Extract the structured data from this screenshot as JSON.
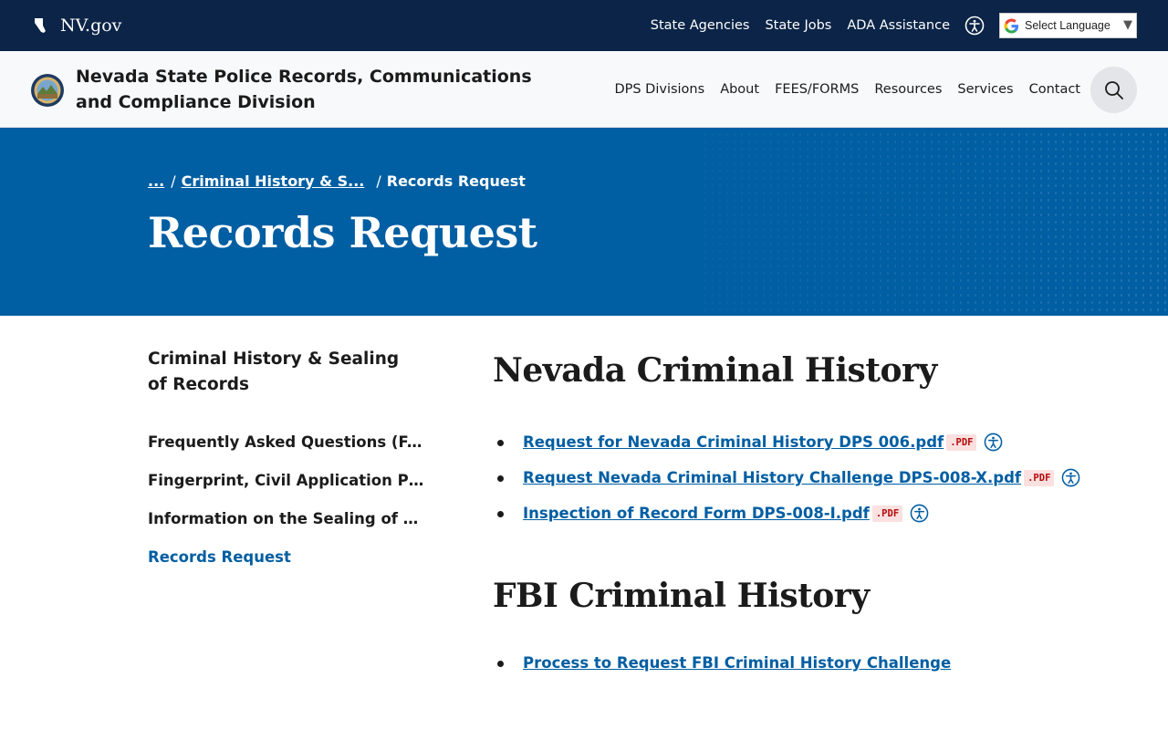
{
  "topbar": {
    "brand": "NV.gov",
    "links": [
      "State Agencies",
      "State Jobs",
      "ADA Assistance"
    ],
    "language_select": "Select Language"
  },
  "header": {
    "site_title": "Nevada State Police Records, Communications and Compliance Division",
    "nav": [
      "DPS Divisions",
      "About",
      "FEES/FORMS",
      "Resources",
      "Services",
      "Contact"
    ]
  },
  "hero": {
    "breadcrumb": {
      "ellipsis": "...",
      "parent": "Criminal History & S...",
      "current": "Records Request",
      "separator": "/"
    },
    "title": "Records Request"
  },
  "sidebar": {
    "title": "Criminal History & Sealing of Records",
    "items": [
      "Frequently Asked Questions (FAQs)",
      "Fingerprint, Civil Application Programs",
      "Information on the Sealing of Nevada Records",
      "Records Request"
    ]
  },
  "main": {
    "sections": [
      {
        "heading": "Nevada Criminal History",
        "links": [
          {
            "label": "Request for Nevada Criminal History DPS 006.pdf",
            "badge": ".PDF"
          },
          {
            "label": "Request Nevada Criminal History Challenge DPS-008-X.pdf",
            "badge": ".PDF"
          },
          {
            "label": "Inspection of Record Form DPS-008-I.pdf",
            "badge": ".PDF"
          }
        ]
      },
      {
        "heading": "FBI Criminal History",
        "links": [
          {
            "label": "Process to Request FBI Criminal History Challenge"
          }
        ]
      }
    ]
  },
  "colors": {
    "topbar": "#0b2447",
    "hero": "#005ea2",
    "link": "#005ea2",
    "pdf_badge_bg": "#fbe0e0",
    "pdf_badge_text": "#b50909"
  },
  "icons": [
    "nevada-state-icon",
    "accessibility-icon",
    "google-icon",
    "chevron-down-icon",
    "state-seal-icon",
    "search-icon"
  ]
}
